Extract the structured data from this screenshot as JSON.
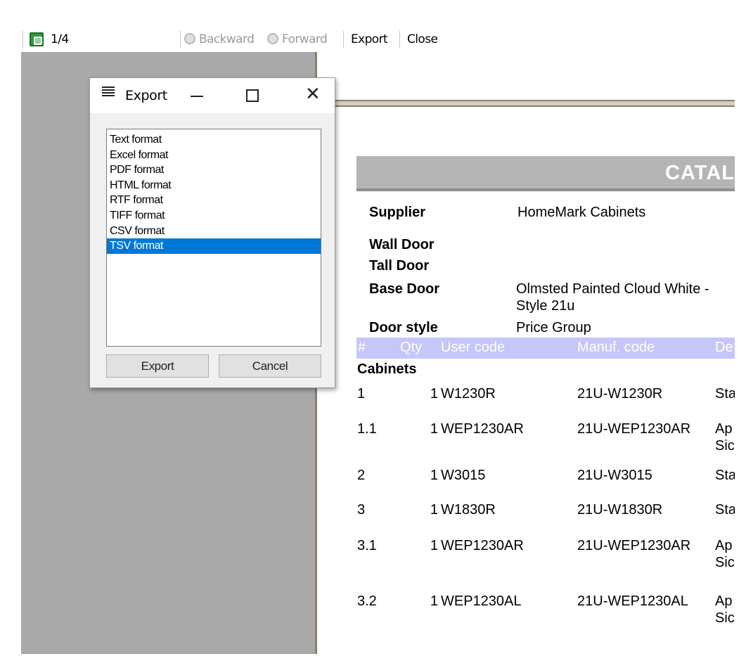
{
  "toolbar": {
    "page_indicator": "1/4",
    "backward_label": "Backward",
    "forward_label": "Forward",
    "export_label": "Export",
    "close_label": "Close"
  },
  "document": {
    "title": "CATAL",
    "supplier_label": "Supplier",
    "supplier_value": "HomeMark Cabinets",
    "wall_door_label": "Wall Door",
    "tall_door_label": "Tall Door",
    "base_door_label": "Base Door",
    "base_door_value_line1": "Olmsted Painted Cloud White -",
    "base_door_value_line2": "Style 21u",
    "door_style_label": "Door style",
    "door_style_value": "Price Group",
    "table_headers": {
      "num": "#",
      "qty": "Qty",
      "user_code": "User code",
      "manuf_code": "Manuf. code",
      "desc": "De"
    },
    "section_label": "Cabinets",
    "rows": [
      {
        "num": "1",
        "qty": "1",
        "user_code": "W1230R",
        "manuf_code": "21U-W1230R",
        "desc1": "Sta",
        "desc2": ""
      },
      {
        "num": "1.1",
        "qty": "1",
        "user_code": "WEP1230AR",
        "manuf_code": "21U-WEP1230AR",
        "desc1": "Ap",
        "desc2": "Sic"
      },
      {
        "num": "2",
        "qty": "1",
        "user_code": "W3015",
        "manuf_code": "21U-W3015",
        "desc1": "Sta",
        "desc2": ""
      },
      {
        "num": "3",
        "qty": "1",
        "user_code": "W1830R",
        "manuf_code": "21U-W1830R",
        "desc1": "Sta",
        "desc2": ""
      },
      {
        "num": "3.1",
        "qty": "1",
        "user_code": "WEP1230AR",
        "manuf_code": "21U-WEP1230AR",
        "desc1": "Ap",
        "desc2": "Sic"
      },
      {
        "num": "3.2",
        "qty": "1",
        "user_code": "WEP1230AL",
        "manuf_code": "21U-WEP1230AL",
        "desc1": "Ap",
        "desc2": "Sic"
      }
    ]
  },
  "dialog": {
    "title": "Export",
    "formats": [
      "Text format",
      "Excel format",
      "PDF format",
      "HTML format",
      "RTF format",
      "TIFF format",
      "CSV format",
      "TSV format"
    ],
    "selected_format": "TSV format",
    "export_button": "Export",
    "cancel_button": "Cancel"
  },
  "colors": {
    "selection": "#0078d7",
    "table_header": "#c6c6fa",
    "title_bar": "#b5b5b5",
    "left_pane": "#a9a9a9"
  }
}
